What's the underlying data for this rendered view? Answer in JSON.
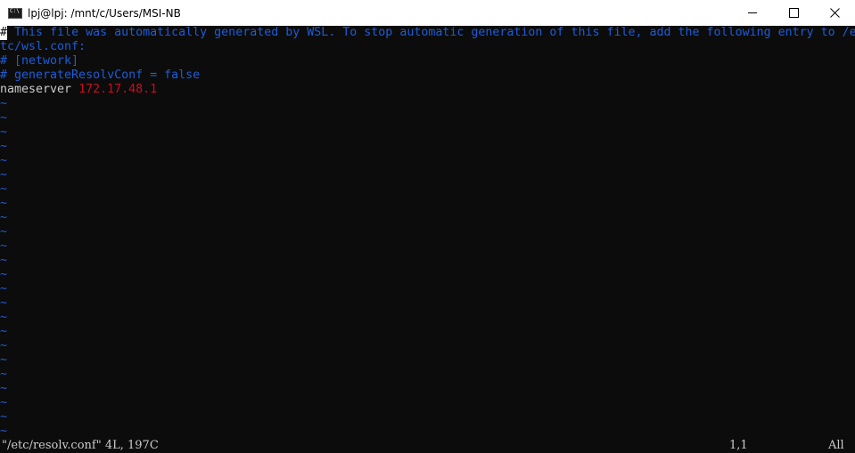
{
  "window": {
    "title": "lpj@lpj: /mnt/c/Users/MSI-NB",
    "icon": "console-icon"
  },
  "controls": {
    "minimize_icon": "minimize-icon",
    "maximize_icon": "maximize-icon",
    "close_icon": "close-icon"
  },
  "editor": {
    "cursor_char": "#",
    "comment_line1_rest": " This file was automatically generated by WSL. To stop automatic generation of this file, add the following entry to /e",
    "comment_line1_wrap": "tc/wsl.conf:",
    "comment_line2": "# [network]",
    "comment_line3": "# generateResolvConf = false",
    "nameserver_key": "nameserver",
    "nameserver_value": "172.17.48.1",
    "tilde": "~",
    "empty_line_count": 24
  },
  "statusline": {
    "file_info": "\"/etc/resolv.conf\" 4L, 197C",
    "position": "1,1",
    "scroll": "All"
  },
  "colors": {
    "background": "#0c0c0c",
    "comment": "#1e5cd6",
    "text": "#cccccc",
    "ip_value": "#c50f1f",
    "titlebar": "#ffffff"
  }
}
